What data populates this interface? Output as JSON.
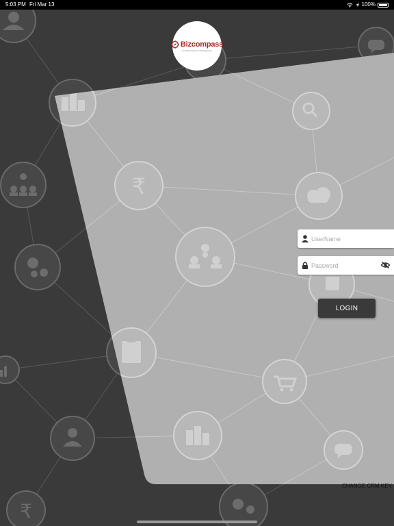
{
  "status_bar": {
    "time": "5:03 PM",
    "date": "Fri Mar 13",
    "battery": "100%",
    "icons": [
      "wifi-icon",
      "location-icon",
      "battery-icon"
    ]
  },
  "logo": {
    "brand": "Bizcompass",
    "tagline": "Complete Business Management"
  },
  "login_form": {
    "username_placeholder": "UserName",
    "password_placeholder": "Password",
    "login_label": "LOGIN"
  },
  "footer": {
    "change_crm_key": "CHANGE CRM KEY"
  },
  "background": {
    "icons": [
      "user-icon",
      "chat-icon",
      "building-icon",
      "search-icon",
      "org-chart-icon",
      "rupee-icon",
      "cloud-upload-icon",
      "gears-icon",
      "document-icon",
      "chart-icon",
      "cart-icon",
      "note-icon"
    ]
  },
  "colors": {
    "dark_background": "#3a3a3a",
    "panel": "#b0b0b0",
    "brand_red": "#b02a2a",
    "login_button": "#3a3a3a"
  }
}
